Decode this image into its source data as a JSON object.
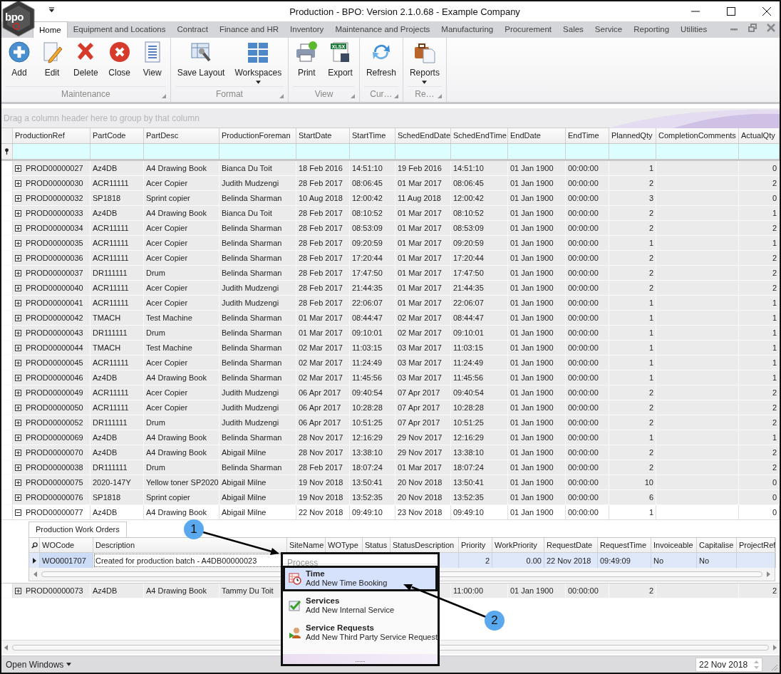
{
  "window": {
    "title": "Production - BPO: Version 2.1.0.68 - Example Company",
    "logo_text": "bpo"
  },
  "ribbon_tabs": [
    {
      "label": "Home",
      "selected": true
    },
    {
      "label": "Equipment and Locations",
      "selected": false
    },
    {
      "label": "Contract",
      "selected": false
    },
    {
      "label": "Finance and HR",
      "selected": false
    },
    {
      "label": "Inventory",
      "selected": false
    },
    {
      "label": "Maintenance and Projects",
      "selected": false
    },
    {
      "label": "Manufacturing",
      "selected": false
    },
    {
      "label": "Procurement",
      "selected": false
    },
    {
      "label": "Sales",
      "selected": false
    },
    {
      "label": "Service",
      "selected": false
    },
    {
      "label": "Reporting",
      "selected": false
    },
    {
      "label": "Utilities",
      "selected": false
    }
  ],
  "ribbon_groups": [
    {
      "label": "Maintenance",
      "buttons": [
        {
          "label": "Add",
          "kind": "add",
          "dropdown": false
        },
        {
          "label": "Edit",
          "kind": "edit",
          "dropdown": false
        },
        {
          "label": "Delete",
          "kind": "delete",
          "dropdown": false
        },
        {
          "label": "Close",
          "kind": "close",
          "dropdown": false
        },
        {
          "label": "View",
          "kind": "view",
          "dropdown": false
        }
      ]
    },
    {
      "label": "Format",
      "buttons": [
        {
          "label": "Save Layout",
          "kind": "layout",
          "dropdown": false
        },
        {
          "label": "Workspaces",
          "kind": "workspaces",
          "dropdown": true
        }
      ]
    },
    {
      "label": "View",
      "buttons": [
        {
          "label": "Print",
          "kind": "print",
          "dropdown": false
        },
        {
          "label": "Export",
          "kind": "export",
          "badge": "XLSX",
          "dropdown": false
        }
      ]
    },
    {
      "label": "Cur…",
      "buttons": [
        {
          "label": "Refresh",
          "kind": "refresh",
          "dropdown": false
        }
      ]
    },
    {
      "label": "Re…",
      "buttons": [
        {
          "label": "Reports",
          "kind": "reports",
          "dropdown": true
        }
      ]
    }
  ],
  "group_panel": {
    "placeholder": "Drag a column header here to group by that column"
  },
  "grid": {
    "columns": [
      {
        "label": "ProductionRef",
        "kind": "text"
      },
      {
        "label": "PartCode",
        "kind": "text"
      },
      {
        "label": "PartDesc",
        "kind": "text"
      },
      {
        "label": "ProductionForeman",
        "kind": "text"
      },
      {
        "label": "StartDate",
        "kind": "text"
      },
      {
        "label": "StartTime",
        "kind": "text"
      },
      {
        "label": "SchedEndDate",
        "kind": "text"
      },
      {
        "label": "SchedEndTime",
        "kind": "text"
      },
      {
        "label": "EndDate",
        "kind": "text"
      },
      {
        "label": "EndTime",
        "kind": "text"
      },
      {
        "label": "PlannedQty",
        "kind": "number"
      },
      {
        "label": "CompletionComments",
        "kind": "text"
      },
      {
        "label": "ActualQty",
        "kind": "number"
      }
    ],
    "rows": [
      {
        "expanded": false,
        "cells": [
          "PROD00000027",
          "Az4DB",
          "A4 Drawing Book",
          "Bianca Du Toit",
          "18 Feb 2016",
          "14:51:10",
          "19 Feb 2016",
          "14:51:10",
          "01 Jan 1900",
          "00:00:00",
          "1",
          null,
          "0"
        ]
      },
      {
        "expanded": false,
        "cells": [
          "PROD00000030",
          "ACR11111",
          "Acer Copier",
          "Judith Mudzengi",
          "28 Feb 2017",
          "08:06:45",
          "01 Mar 2017",
          "08:06:45",
          "01 Jan 1900",
          "00:00:00",
          "2",
          null,
          "2"
        ]
      },
      {
        "expanded": false,
        "cells": [
          "PROD00000032",
          "SP1818",
          "Sprint copier",
          "Belinda Sharman",
          "10 Aug 2018",
          "12:00:42",
          "11 Aug 2018",
          "12:00:42",
          "01 Jan 1900",
          "00:00:00",
          "3",
          null,
          "0"
        ]
      },
      {
        "expanded": false,
        "cells": [
          "PROD00000033",
          "Az4DB",
          "A4 Drawing Book",
          "Bianca Du Toit",
          "28 Feb 2017",
          "08:10:52",
          "01 Mar 2017",
          "08:10:52",
          "01 Jan 1900",
          "00:00:00",
          "2",
          null,
          "1"
        ]
      },
      {
        "expanded": false,
        "cells": [
          "PROD00000034",
          "ACR11111",
          "Acer Copier",
          "Belinda Sharman",
          "28 Feb 2017",
          "08:53:09",
          "01 Mar 2017",
          "08:53:09",
          "01 Jan 1900",
          "00:00:00",
          "2",
          null,
          "2"
        ]
      },
      {
        "expanded": false,
        "cells": [
          "PROD00000035",
          "ACR11111",
          "Acer Copier",
          "Belinda Sharman",
          "28 Feb 2017",
          "09:20:59",
          "01 Mar 2017",
          "09:20:59",
          "01 Jan 1900",
          "00:00:00",
          "1",
          null,
          "1"
        ]
      },
      {
        "expanded": false,
        "cells": [
          "PROD00000036",
          "ACR11111",
          "Acer Copier",
          "Belinda Sharman",
          "28 Feb 2017",
          "17:20:44",
          "01 Mar 2017",
          "17:20:44",
          "01 Jan 1900",
          "00:00:00",
          "2",
          null,
          "2"
        ]
      },
      {
        "expanded": false,
        "cells": [
          "PROD00000037",
          "DR111111",
          "Drum",
          "Belinda Sharman",
          "28 Feb 2017",
          "17:47:50",
          "01 Mar 2017",
          "17:47:50",
          "01 Jan 1900",
          "00:00:00",
          "2",
          null,
          "2"
        ]
      },
      {
        "expanded": false,
        "cells": [
          "PROD00000040",
          "ACR11111",
          "Acer Copier",
          "Judith Mudzengi",
          "28 Feb 2017",
          "21:44:35",
          "01 Mar 2017",
          "21:44:35",
          "01 Jan 1900",
          "00:00:00",
          "2",
          null,
          "2"
        ]
      },
      {
        "expanded": false,
        "cells": [
          "PROD00000041",
          "ACR11111",
          "Acer Copier",
          "Judith Mudzengi",
          "28 Feb 2017",
          "22:06:07",
          "01 Mar 2017",
          "22:06:07",
          "01 Jan 1900",
          "00:00:00",
          "1",
          null,
          "1"
        ]
      },
      {
        "expanded": false,
        "cells": [
          "PROD00000042",
          "TMACH",
          "Test Machine",
          "Belinda Sharman",
          "01 Mar 2017",
          "08:44:47",
          "02 Mar 2017",
          "08:44:47",
          "01 Jan 1900",
          "00:00:00",
          "1",
          null,
          "1"
        ]
      },
      {
        "expanded": false,
        "cells": [
          "PROD00000043",
          "DR111111",
          "Drum",
          "Belinda Sharman",
          "01 Mar 2017",
          "09:10:01",
          "02 Mar 2017",
          "09:10:01",
          "01 Jan 1900",
          "00:00:00",
          "1",
          null,
          "1"
        ]
      },
      {
        "expanded": false,
        "cells": [
          "PROD00000044",
          "TMACH",
          "Test Machine",
          "Belinda Sharman",
          "02 Mar 2017",
          "11:03:15",
          "03 Mar 2017",
          "11:03:15",
          "01 Jan 1900",
          "00:00:00",
          "1",
          null,
          "1"
        ]
      },
      {
        "expanded": false,
        "cells": [
          "PROD00000045",
          "ACR11111",
          "Acer Copier",
          "Belinda Sharman",
          "02 Mar 2017",
          "11:24:49",
          "03 Mar 2017",
          "11:24:49",
          "01 Jan 1900",
          "00:00:00",
          "1",
          null,
          "1"
        ]
      },
      {
        "expanded": false,
        "cells": [
          "PROD00000046",
          "Az4DB",
          "A4 Drawing Book",
          "Belinda Sharman",
          "02 Mar 2017",
          "11:45:56",
          "03 Mar 2017",
          "11:45:56",
          "01 Jan 1900",
          "00:00:00",
          "1",
          null,
          "1"
        ]
      },
      {
        "expanded": false,
        "cells": [
          "PROD00000049",
          "ACR11111",
          "Acer Copier",
          "Judith Mudzengi",
          "06 Apr 2017",
          "09:40:54",
          "07 Apr 2017",
          "09:40:54",
          "01 Jan 1900",
          "00:00:00",
          "2",
          null,
          "2"
        ]
      },
      {
        "expanded": false,
        "cells": [
          "PROD00000050",
          "ACR11111",
          "Acer Copier",
          "Judith Mudzengi",
          "06 Apr 2017",
          "10:28:28",
          "07 Apr 2017",
          "10:28:28",
          "01 Jan 1900",
          "00:00:00",
          "2",
          null,
          "2"
        ]
      },
      {
        "expanded": false,
        "cells": [
          "PROD00000052",
          "DR111111",
          "Drum",
          "Judith Mudzengi",
          "06 Apr 2017",
          "10:51:25",
          "07 Apr 2017",
          "10:51:25",
          "01 Jan 1900",
          "00:00:00",
          "2",
          null,
          "2"
        ]
      },
      {
        "expanded": false,
        "cells": [
          "PROD00000069",
          "Az4DB",
          "A4 Drawing Book",
          "Belinda Sharman",
          "28 Nov 2017",
          "12:16:29",
          "29 Nov 2017",
          "12:16:29",
          "01 Jan 1900",
          "00:00:00",
          "1",
          null,
          "1"
        ]
      },
      {
        "expanded": false,
        "cells": [
          "PROD00000070",
          "Az4DB",
          "A4 Drawing Book",
          "Abigail Milne",
          "28 Nov 2017",
          "13:38:10",
          "29 Nov 2017",
          "13:38:10",
          "01 Jan 1900",
          "00:00:00",
          "2",
          null,
          "2"
        ]
      },
      {
        "expanded": false,
        "cells": [
          "PROD00000038",
          "DR111111",
          "Drum",
          "Belinda Sharman",
          "28 Feb 2017",
          "18:07:24",
          "01 Mar 2017",
          "18:07:24",
          "01 Jan 1900",
          "00:00:00",
          "2",
          null,
          "2"
        ]
      },
      {
        "expanded": false,
        "cells": [
          "PROD00000075",
          "2020-147Y",
          "Yellow toner SP2020",
          "Abigail Milne",
          "19 Nov 2018",
          "13:50:41",
          "20 Nov 2018",
          "13:50:41",
          "01 Jan 1900",
          "00:00:00",
          "10",
          null,
          "0"
        ]
      },
      {
        "expanded": false,
        "cells": [
          "PROD00000076",
          "SP1818",
          "Sprint copier",
          "Abigail Milne",
          "19 Nov 2018",
          "13:52:35",
          "20 Nov 2018",
          "13:52:35",
          "01 Jan 1900",
          "00:00:00",
          "6",
          null,
          "0"
        ]
      },
      {
        "expanded": true,
        "cells": [
          "PROD00000077",
          "Az4DB",
          "A4 Drawing Book",
          "Abigail Milne",
          "22 Nov 2018",
          "09:49:10",
          "23 Nov 2018",
          "09:49:10",
          "01 Jan 1900",
          "00:00:00",
          "1",
          null,
          "0"
        ]
      },
      {
        "expanded": false,
        "cells": [
          "PROD00000073",
          "Az4DB",
          "A4 Drawing Book",
          "Tammy Du Toit",
          null,
          null,
          null,
          "11:00:00",
          "01 Jan 1900",
          "00:00:00",
          "2",
          null,
          "2"
        ]
      }
    ]
  },
  "detail": {
    "tab": {
      "label": "Production Work Orders",
      "selected": true
    },
    "columns": [
      {
        "label": "WOCode",
        "kind": "text"
      },
      {
        "label": "Description",
        "kind": "text"
      },
      {
        "label": "SiteName",
        "kind": "text"
      },
      {
        "label": "WOType",
        "kind": "text"
      },
      {
        "label": "Status",
        "kind": "text"
      },
      {
        "label": "StatusDescription",
        "kind": "text"
      },
      {
        "label": "Priority",
        "kind": "number"
      },
      {
        "label": "WorkPriority",
        "kind": "number"
      },
      {
        "label": "RequestDate",
        "kind": "text"
      },
      {
        "label": "RequestTime",
        "kind": "text"
      },
      {
        "label": "Invoiceable",
        "kind": "text"
      },
      {
        "label": "Capitalise",
        "kind": "text"
      },
      {
        "label": "ProjectRef",
        "kind": "text"
      }
    ],
    "rows": [
      {
        "cells": [
          "WO0001707",
          "Created for production batch - A4DB00000023",
          null,
          null,
          null,
          null,
          "2",
          "0.00",
          "22 Nov 2018",
          "09:49:09",
          "No",
          "No",
          null
        ]
      }
    ]
  },
  "context_menu": {
    "header": "Process",
    "items": [
      {
        "title": "Time",
        "subtitle": "Add New Time Booking",
        "kind": "time",
        "selected": true
      },
      {
        "title": "Services",
        "subtitle": "Add New Internal Service",
        "kind": "services",
        "selected": false
      },
      {
        "title": "Service Requests",
        "subtitle": "Add New Third Party Service Request",
        "kind": "requests",
        "selected": false
      }
    ]
  },
  "callouts": [
    {
      "label": "1"
    },
    {
      "label": "2"
    }
  ],
  "status_bar": {
    "open_windows": "Open Windows",
    "date": "22 Nov 2018"
  }
}
